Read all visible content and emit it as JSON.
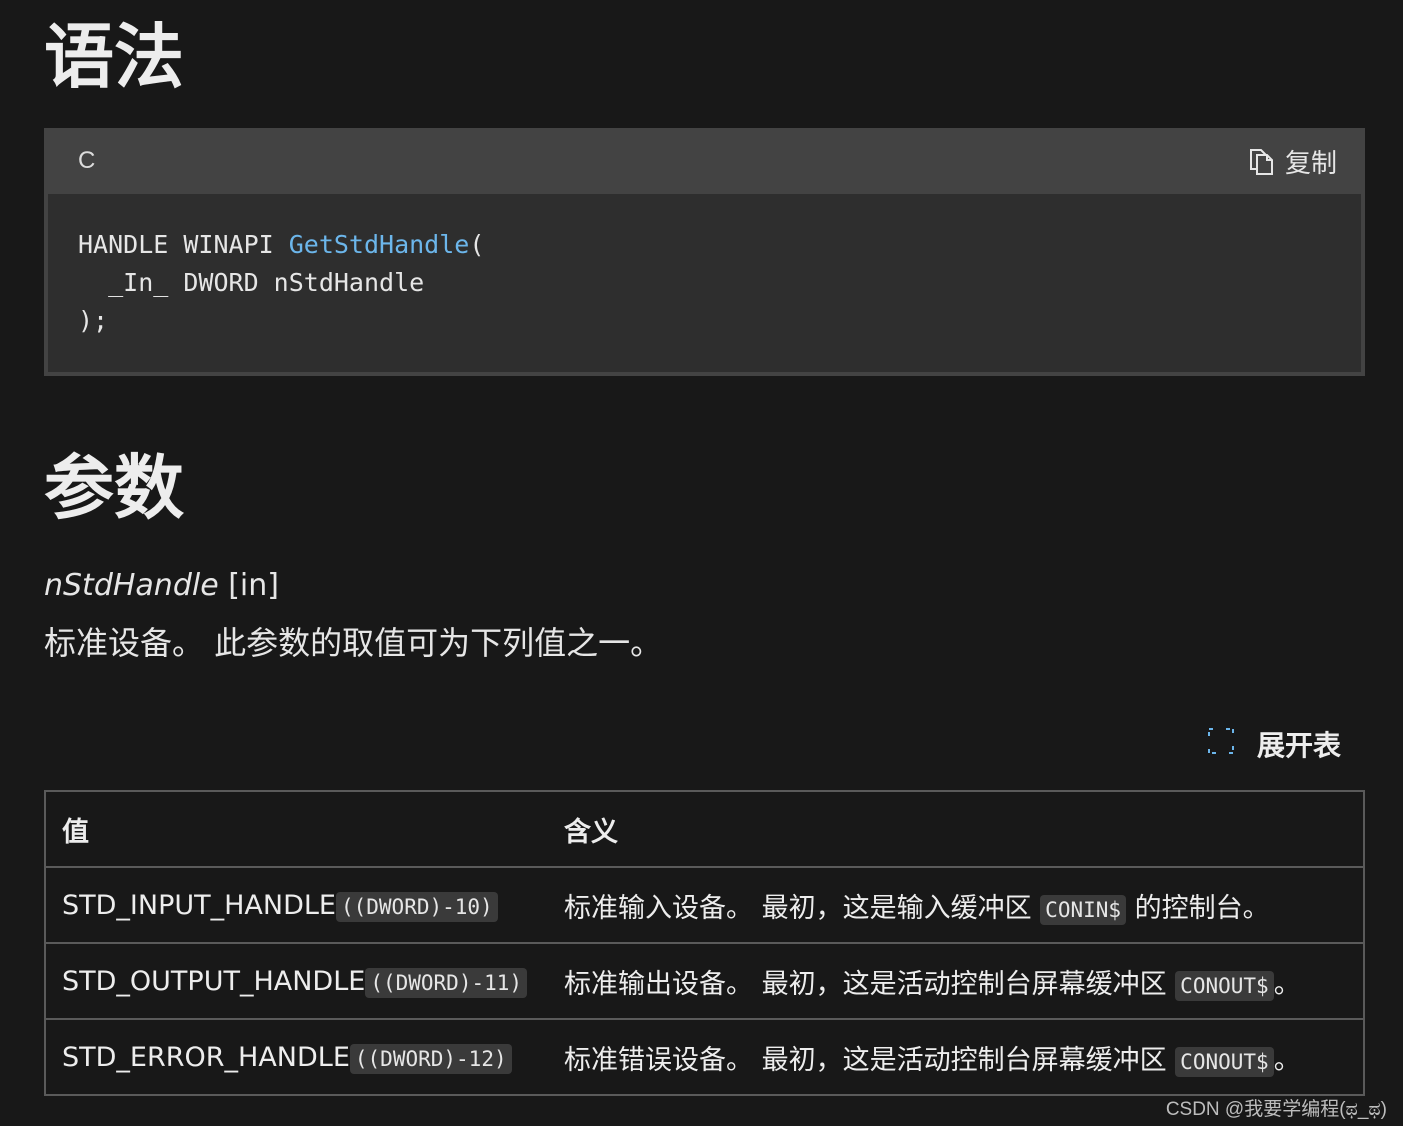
{
  "headings": {
    "syntax": "语法",
    "parameters": "参数"
  },
  "code_block": {
    "language": "C",
    "copy_label": "复制",
    "copy_icon": "copy-icon",
    "line1_pre": "HANDLE WINAPI ",
    "line1_fn": "GetStdHandle",
    "line1_post": "(",
    "line2": "  _In_ DWORD nStdHandle",
    "line3": ");"
  },
  "parameter": {
    "name": "nStdHandle",
    "direction": "[in]",
    "description": "标准设备。 此参数的取值可为下列值之一。"
  },
  "expand_table": {
    "label": "展开表",
    "icon": "expand-icon"
  },
  "table": {
    "headers": [
      "值",
      "含义"
    ],
    "rows": [
      {
        "name": "STD_INPUT_HANDLE",
        "code": "((DWORD)-10)",
        "desc_pre": "标准输入设备。 最初，这是输入缓冲区 ",
        "desc_code": "CONIN$",
        "desc_post": " 的控制台。"
      },
      {
        "name": "STD_OUTPUT_HANDLE",
        "code": "((DWORD)-11)",
        "desc_pre": "标准输出设备。 最初，这是活动控制台屏幕缓冲区 ",
        "desc_code": "CONOUT$",
        "desc_post": "。"
      },
      {
        "name": "STD_ERROR_HANDLE",
        "code": "((DWORD)-12)",
        "desc_pre": "标准错误设备。 最初，这是活动控制台屏幕缓冲区 ",
        "desc_code": "CONOUT$",
        "desc_post": "。"
      }
    ]
  },
  "watermark": "CSDN @我要学编程(ಥ_ಥ)",
  "colors": {
    "background": "#181818",
    "code_header": "#434343",
    "code_body": "#2e2e2e",
    "function_name": "#6cb6eb",
    "expand_icon": "#6cb6eb"
  }
}
